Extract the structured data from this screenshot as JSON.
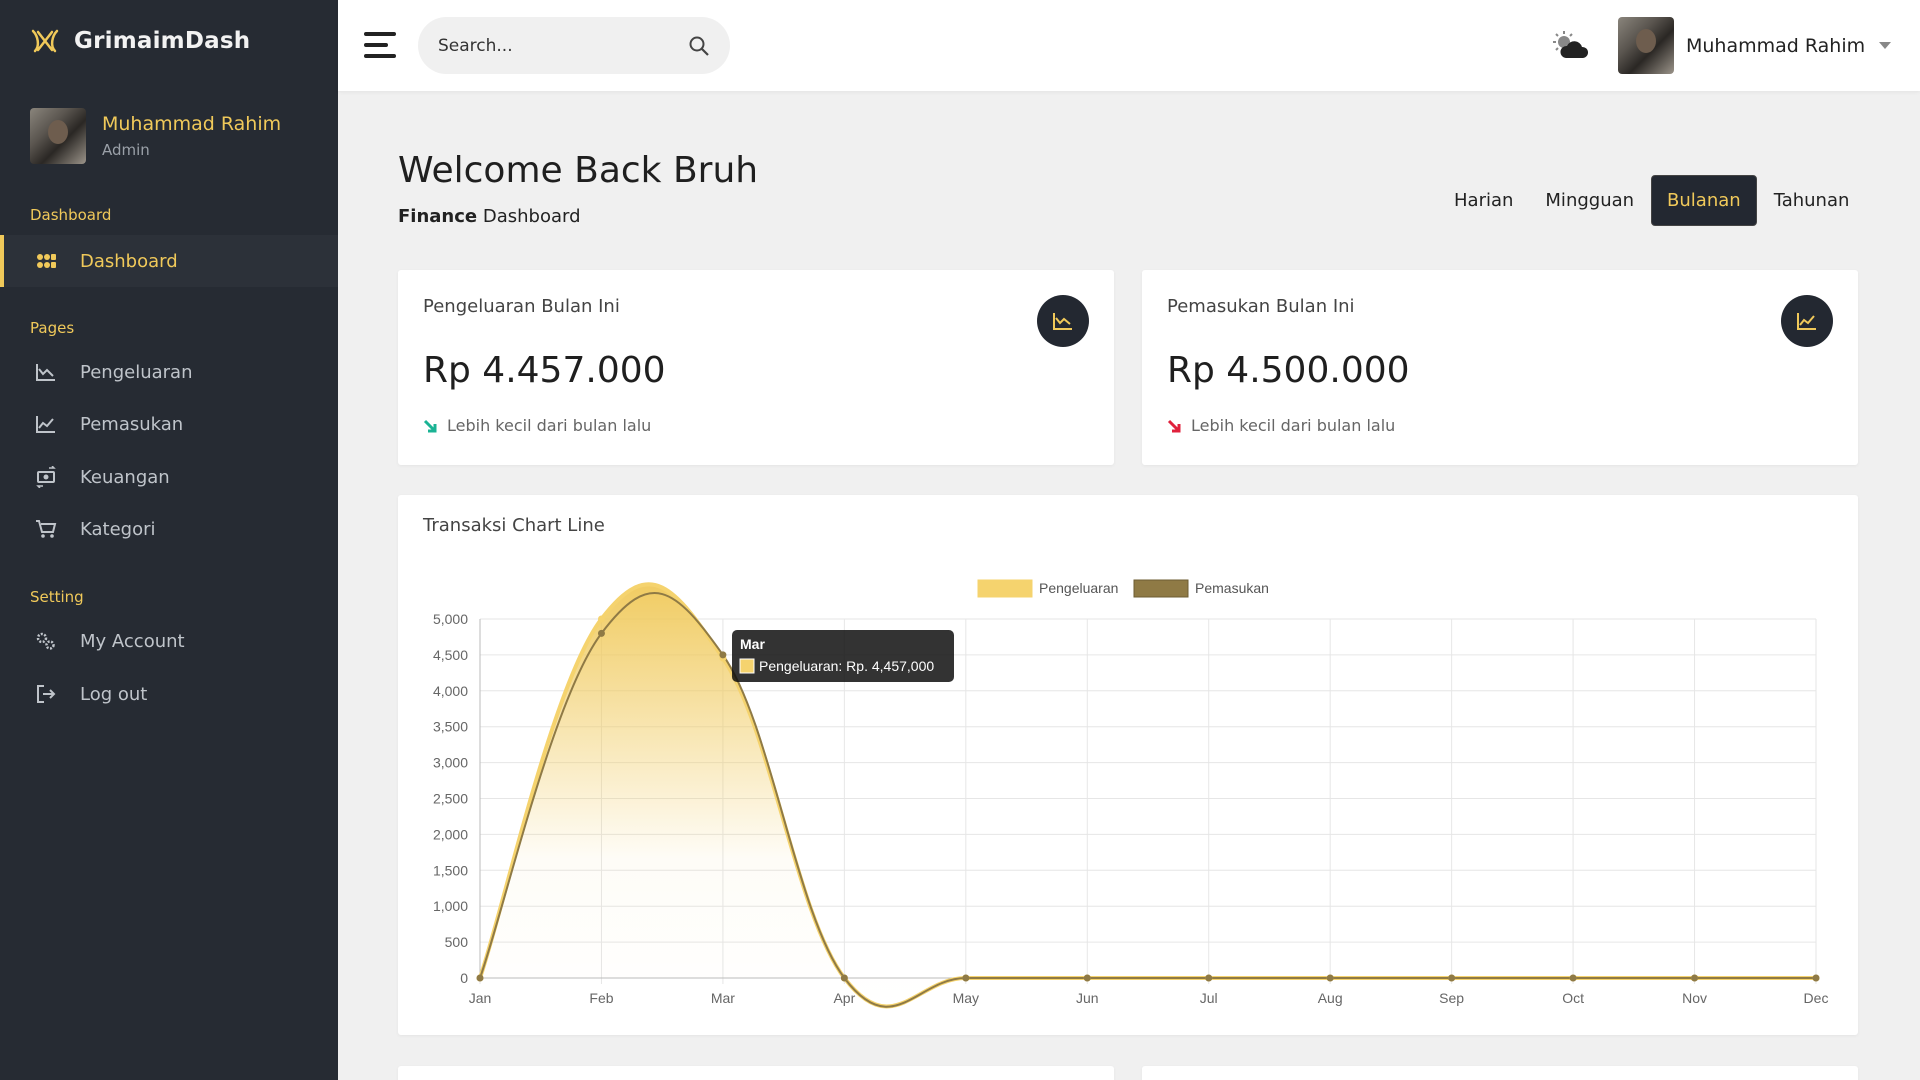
{
  "sidebar": {
    "brand": "GrimaimDash",
    "profile": {
      "name": "Muhammad Rahim",
      "role": "Admin"
    },
    "sections": {
      "dashboard": "Dashboard",
      "pages": "Pages",
      "setting": "Setting"
    },
    "items": [
      {
        "label": "Dashboard",
        "icon": "grid-icon",
        "active": true
      },
      {
        "label": "Pengeluaran",
        "icon": "chart-down-icon"
      },
      {
        "label": "Pemasukan",
        "icon": "chart-up-icon"
      },
      {
        "label": "Keuangan",
        "icon": "money-exchange-icon"
      },
      {
        "label": "Kategori",
        "icon": "cart-icon"
      },
      {
        "label": "My Account",
        "icon": "gears-icon"
      },
      {
        "label": "Log out",
        "icon": "logout-icon"
      }
    ]
  },
  "topbar": {
    "search_placeholder": "Search...",
    "user_name": "Muhammad Rahim"
  },
  "main": {
    "welcome": "Welcome Back Bruh",
    "subtitle_bold": "Finance",
    "subtitle_rest": " Dashboard",
    "period_tabs": [
      "Harian",
      "Mingguan",
      "Bulanan",
      "Tahunan"
    ],
    "active_period": "Bulanan",
    "cards": [
      {
        "title": "Pengeluaran Bulan Ini",
        "value": "Rp 4.457.000",
        "note": "Lebih kecil dari bulan lalu",
        "note_color": "#1ab394",
        "icon": "chart-down-icon"
      },
      {
        "title": "Pemasukan Bulan Ini",
        "value": "Rp 4.500.000",
        "note": "Lebih kecil dari bulan lalu",
        "note_color": "#e0213c",
        "icon": "chart-up-icon"
      }
    ],
    "chart_title": "Transaksi Chart Line"
  },
  "colors": {
    "accent": "#f0c95a",
    "sidebar_bg": "#262b33",
    "pengeluaran": "#f5d36e",
    "pemasukan": "#8f7a45"
  },
  "chart_data": {
    "type": "line",
    "categories": [
      "Jan",
      "Feb",
      "Mar",
      "Apr",
      "May",
      "Jun",
      "Jul",
      "Aug",
      "Sep",
      "Oct",
      "Nov",
      "Dec"
    ],
    "series": [
      {
        "name": "Pengeluaran",
        "values": [
          0,
          5000,
          4457,
          0,
          0,
          0,
          0,
          0,
          0,
          0,
          0,
          0
        ],
        "color": "#f5d36e"
      },
      {
        "name": "Pemasukan",
        "values": [
          0,
          4800,
          4500,
          0,
          0,
          0,
          0,
          0,
          0,
          0,
          0,
          0
        ],
        "color": "#8f7a45"
      }
    ],
    "ylim": [
      0,
      5000
    ],
    "yticks": [
      "5,000",
      "4,500",
      "4,000",
      "3,500",
      "3,000",
      "2,500",
      "2,000",
      "1,500",
      "1,000",
      "500",
      "0"
    ],
    "ytick_values": [
      5000,
      4500,
      4000,
      3500,
      3000,
      2500,
      2000,
      1500,
      1000,
      500,
      0
    ],
    "grid": true,
    "legend": "top-center",
    "tooltip": {
      "title": "Mar",
      "text": "Pengeluaran: Rp. 4,457,000"
    }
  }
}
